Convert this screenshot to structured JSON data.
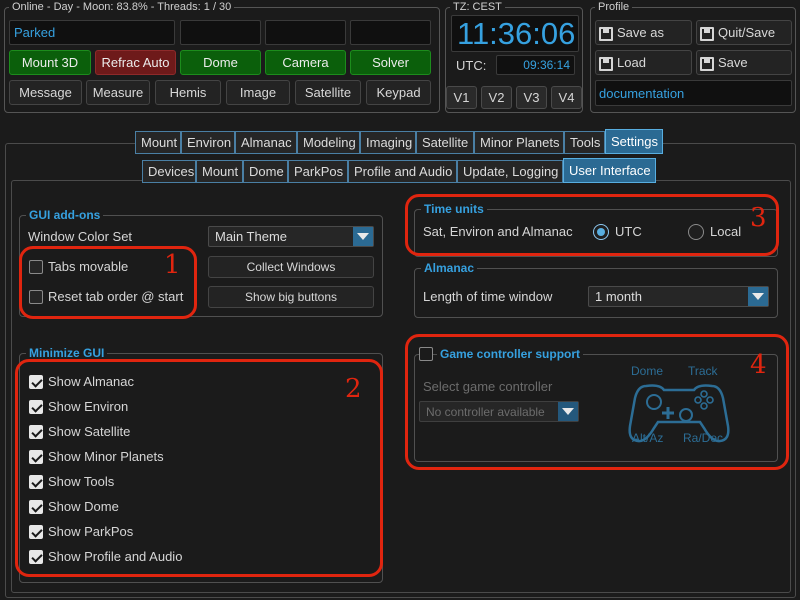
{
  "status": {
    "header": "Online - Day - Moon: 83.8% - Threads: 1 / 30",
    "state": "Parked",
    "row1": [
      "Mount 3D",
      "Refrac Auto",
      "Dome",
      "Camera",
      "Solver"
    ],
    "row2": [
      "Message",
      "Measure",
      "Hemis",
      "Image",
      "Satellite",
      "Keypad"
    ]
  },
  "clock": {
    "tz": "TZ: CEST",
    "time": "11:36:06",
    "utc_label": "UTC:",
    "utc_time": "09:36:14",
    "versions": [
      "V1",
      "V2",
      "V3",
      "V4"
    ]
  },
  "profile": {
    "title": "Profile",
    "buttons": [
      "Save as",
      "Quit/Save",
      "Load",
      "Save"
    ],
    "name": "documentation"
  },
  "main_tabs": [
    "Mount",
    "Environ",
    "Almanac",
    "Modeling",
    "Imaging",
    "Satellite",
    "Minor Planets",
    "Tools",
    "Settings"
  ],
  "sub_tabs": [
    "Devices",
    "Mount",
    "Dome",
    "ParkPos",
    "Profile and Audio",
    "Update, Logging",
    "User Interface"
  ],
  "gui_addons": {
    "title": "GUI add-ons",
    "window_color_label": "Window Color Set",
    "window_color_value": "Main Theme",
    "tabs_movable": "Tabs movable",
    "reset_tab_order": "Reset tab order @ start",
    "collect_windows": "Collect Windows",
    "show_big_buttons": "Show big buttons"
  },
  "minimize_gui": {
    "title": "Minimize GUI",
    "items": [
      "Show Almanac",
      "Show Environ",
      "Show Satellite",
      "Show Minor Planets",
      "Show Tools",
      "Show Dome",
      "Show ParkPos",
      "Show Profile and Audio"
    ]
  },
  "time_units": {
    "title": "Time units",
    "label": "Sat, Environ and Almanac",
    "utc": "UTC",
    "local": "Local"
  },
  "almanac": {
    "title": "Almanac",
    "label": "Length of time window",
    "value": "1 month"
  },
  "game_controller": {
    "title": "Game controller support",
    "select_label": "Select game controller",
    "select_value": "No controller available",
    "dome": "Dome",
    "track": "Track",
    "altaz": "Alt/Az",
    "radec": "Ra/Dec"
  },
  "annotations": [
    "1",
    "2",
    "3",
    "4"
  ],
  "colors": {
    "accent_blue": "#36a1e0",
    "tab_active": "#2b6a93",
    "green_button": "#0b5f0b",
    "red_button": "#6e1a1a",
    "annotation_red": "#e0250f"
  }
}
